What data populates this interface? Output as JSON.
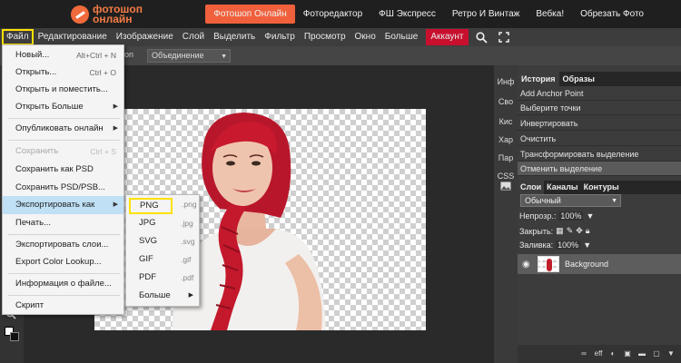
{
  "brand": {
    "line1": "фотошоп",
    "line2": "онлайн"
  },
  "site_nav": [
    "Фотошоп Онлайн",
    "Фоторедактор",
    "ФШ Экспресс",
    "Ретро И Винтаж",
    "Вебка!",
    "Обрезать Фото"
  ],
  "menu": [
    "Файл",
    "Редактирование",
    "Изображение",
    "Слой",
    "Выделить",
    "Фильтр",
    "Просмотр",
    "Окно",
    "Больше"
  ],
  "account_label": "Аккаунт",
  "options_bar": {
    "label": "on",
    "blend_value": "Объединение"
  },
  "file_menu": {
    "items": [
      {
        "label": "Новый...",
        "shortcut": "Alt+Ctrl + N"
      },
      {
        "label": "Открыть...",
        "shortcut": "Ctrl + O"
      },
      {
        "label": "Открыть и поместить...",
        "shortcut": ""
      },
      {
        "label": "Открыть Больше",
        "shortcut": ""
      },
      {
        "label": "Опубликовать онлайн",
        "shortcut": ""
      },
      {
        "label": "Сохранить",
        "shortcut": "Ctrl + S"
      },
      {
        "label": "Сохранить как PSD",
        "shortcut": ""
      },
      {
        "label": "Сохранить PSD/PSB...",
        "shortcut": ""
      },
      {
        "label": "Экспортировать как",
        "shortcut": ""
      },
      {
        "label": "Печать...",
        "shortcut": ""
      },
      {
        "label": "Экспортировать слои...",
        "shortcut": ""
      },
      {
        "label": "Export Color Lookup...",
        "shortcut": ""
      },
      {
        "label": "Информация о файле...",
        "shortcut": ""
      },
      {
        "label": "Скрипт",
        "shortcut": ""
      }
    ]
  },
  "export_submenu": [
    {
      "label": "PNG",
      "ext": ".png"
    },
    {
      "label": "JPG",
      "ext": ".jpg"
    },
    {
      "label": "SVG",
      "ext": ".svg"
    },
    {
      "label": "GIF",
      "ext": ".gif"
    },
    {
      "label": "PDF",
      "ext": ".pdf"
    },
    {
      "label": "Больше",
      "ext": ""
    }
  ],
  "side_tabs": [
    "Инф",
    "Сво",
    "Кис",
    "Хар",
    "Пар",
    "CSS"
  ],
  "history": {
    "tabs": [
      "История",
      "Образы"
    ],
    "items": [
      "Add Anchor Point",
      "Выберите точки",
      "Инвертировать",
      "Очистить",
      "Трансформировать выделение",
      "Отменить выделение"
    ]
  },
  "layers": {
    "tabs": [
      "Слои",
      "Каналы",
      "Контуры"
    ],
    "blend_mode": "Обычный",
    "opacity_label": "Непрозр.:",
    "opacity_value": "100%",
    "lock_label": "Закрыть:",
    "fill_label": "Заливка:",
    "fill_value": "100%",
    "layer_name": "Background",
    "footer_text": "eff"
  },
  "colors": {
    "accent": "#f0603c",
    "account": "#c8102e",
    "highlight_box": "#ffe100",
    "menu_hover": "#bfe0f5"
  }
}
